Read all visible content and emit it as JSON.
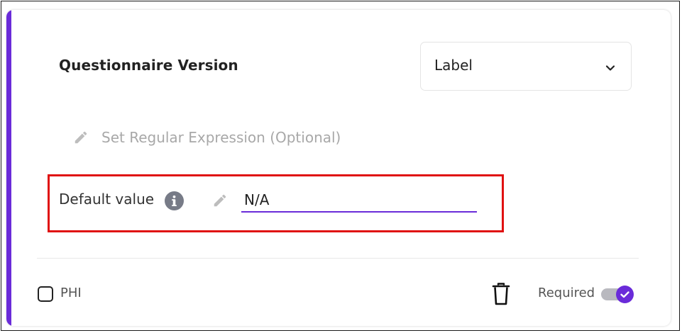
{
  "field": {
    "title": "Questionnaire Version",
    "type_select": {
      "selected": "Label",
      "icon": "chevron-down-icon"
    },
    "regex": {
      "icon": "pencil-icon",
      "label": "Set Regular Expression (Optional)"
    },
    "default_value": {
      "label": "Default value",
      "info_icon": "info-icon",
      "edit_icon": "pencil-icon",
      "value": "N/A"
    }
  },
  "footer": {
    "phi": {
      "label": "PHI",
      "checked": false
    },
    "delete_icon": "trash-icon",
    "required": {
      "label": "Required",
      "enabled": true
    }
  },
  "colors": {
    "accent": "#6a2bd9",
    "highlight": "#e01010",
    "muted_text": "#a8a8a8",
    "info_icon_bg": "#777b87",
    "toggle_track": "#b9b9bf"
  }
}
